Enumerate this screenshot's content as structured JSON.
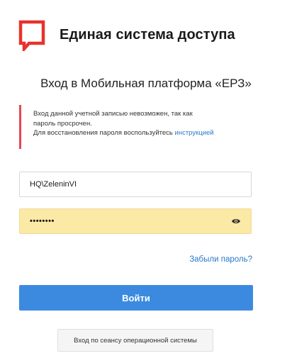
{
  "header": {
    "brand": "Единая система доступа",
    "logo_icon": "speech-bubble-logo-icon",
    "logo_color": "#e8322c"
  },
  "subtitle": "Вход в Мобильная платформа «ЕРЗ»",
  "alert": {
    "line1": "Вход данной учетной записью невозможен, так как",
    "line2": "пароль просрочен.",
    "line3_prefix": "Для восстановления пароля воспользуйтесь ",
    "link": "инструкцией",
    "accent_color": "#e8474e"
  },
  "form": {
    "username_value": "HQ\\ZeleninVI",
    "password_value": "••••••••",
    "password_toggle_icon": "eye-icon",
    "forgot_link": "Забыли пароль?",
    "submit_label": "Войти",
    "os_session_label": "Вход по сеансу операционной системы"
  },
  "colors": {
    "primary": "#3c8ae0",
    "link": "#2a78c9",
    "autofill": "#fbe9a6"
  }
}
